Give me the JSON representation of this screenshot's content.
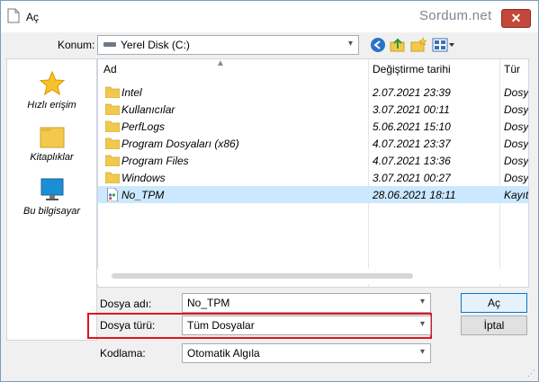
{
  "window": {
    "title": "Aç",
    "watermark": "Sordum.net",
    "close_glyph": "✕"
  },
  "toolbar": {
    "location_label": "Konum:",
    "location_value": "Yerel Disk (C:)",
    "icons": [
      "back-icon",
      "up-folder-icon",
      "new-folder-icon",
      "view-menu-icon"
    ]
  },
  "places": [
    {
      "label": "Hızlı erişim",
      "icon": "star-icon"
    },
    {
      "label": "Kitaplıklar",
      "icon": "library-icon"
    },
    {
      "label": "Bu bilgisayar",
      "icon": "computer-icon"
    }
  ],
  "filelist": {
    "columns": [
      "Ad",
      "Değiştirme tarihi",
      "Tür"
    ],
    "rows": [
      {
        "name": "Intel",
        "date": "2.07.2021 23:39",
        "type": "Dosya",
        "icon": "folder-icon"
      },
      {
        "name": "Kullanıcılar",
        "date": "3.07.2021 00:11",
        "type": "Dosya",
        "icon": "folder-icon"
      },
      {
        "name": "PerfLogs",
        "date": "5.06.2021 15:10",
        "type": "Dosya",
        "icon": "folder-icon"
      },
      {
        "name": "Program Dosyaları (x86)",
        "date": "4.07.2021 23:37",
        "type": "Dosya",
        "icon": "folder-icon"
      },
      {
        "name": "Program Files",
        "date": "4.07.2021 13:36",
        "type": "Dosya",
        "icon": "folder-icon"
      },
      {
        "name": "Windows",
        "date": "3.07.2021 00:27",
        "type": "Dosya",
        "icon": "folder-icon"
      },
      {
        "name": "No_TPM",
        "date": "28.06.2021 18:11",
        "type": "Kayıt",
        "icon": "registry-file-icon",
        "selected": true
      }
    ]
  },
  "form": {
    "filename_label": "Dosya adı:",
    "filename_value": "No_TPM",
    "filetype_label": "Dosya türü:",
    "filetype_value": "Tüm Dosyalar",
    "encoding_label": "Kodlama:",
    "encoding_value": "Otomatik Algıla"
  },
  "buttons": {
    "open": "Aç",
    "cancel": "İptal"
  },
  "colors": {
    "selection": "#cce8ff",
    "highlight_box": "#e0141e",
    "close_button": "#c5463a"
  }
}
